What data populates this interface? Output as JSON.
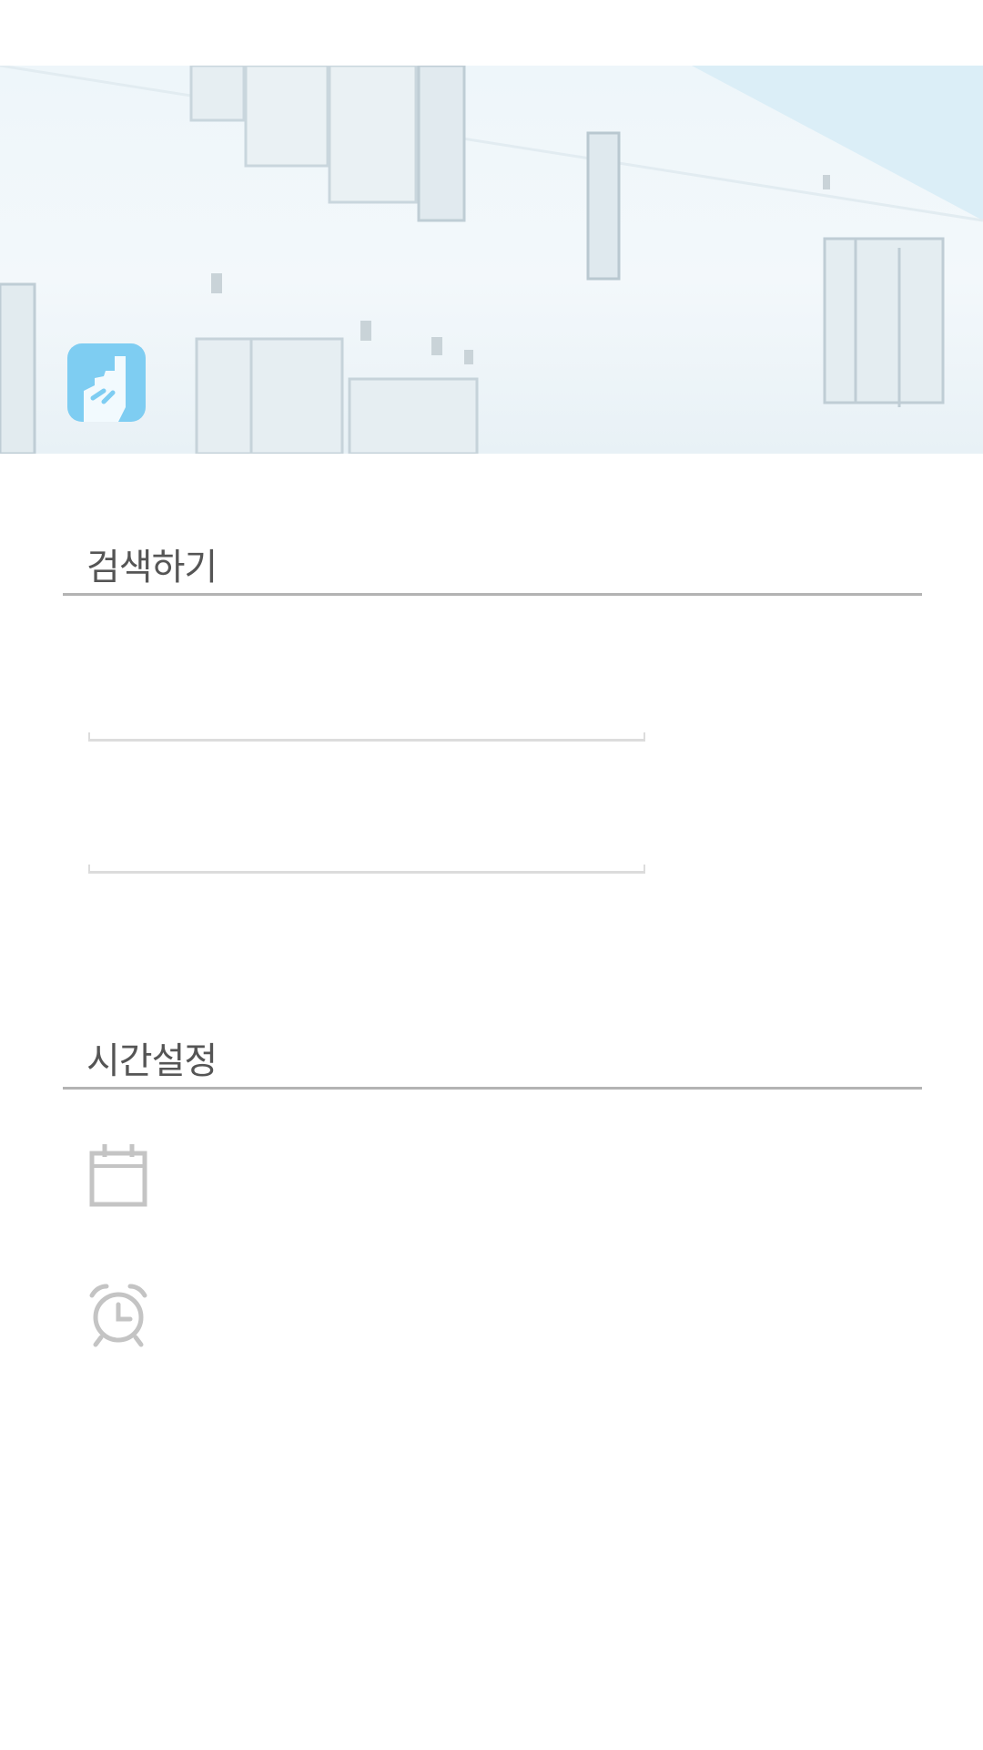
{
  "search_section": {
    "title": "검색하기",
    "field_1": {
      "value": "",
      "placeholder": ""
    },
    "field_2": {
      "value": "",
      "placeholder": ""
    }
  },
  "time_section": {
    "title": "시간설정",
    "date_row": {
      "icon": "calendar-icon",
      "value": ""
    },
    "alarm_row": {
      "icon": "alarm-clock-icon",
      "value": ""
    }
  },
  "colors": {
    "logo_bg": "#7ecdf2",
    "section_text": "#555555",
    "rule": "#b3b3b3",
    "icon_gray": "#c4c4c4"
  }
}
